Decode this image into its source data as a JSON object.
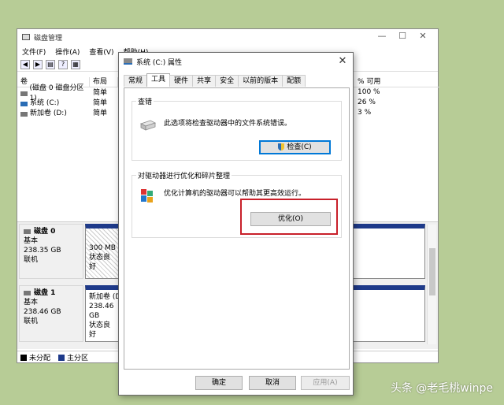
{
  "disk_manager": {
    "title": "磁盘管理",
    "menu": [
      "文件(F)",
      "操作(A)",
      "查看(V)",
      "帮助(H)"
    ],
    "columns": [
      "卷",
      "布局"
    ],
    "pct_header": "% 可用",
    "volumes": [
      {
        "name": "(磁盘 0 磁盘分区 1)",
        "layout": "简单",
        "pct": "100 %"
      },
      {
        "name": "系统 (C:)",
        "layout": "简单",
        "pct": "26 %"
      },
      {
        "name": "新加卷 (D:)",
        "layout": "简单",
        "pct": "3 %"
      }
    ],
    "disk0": {
      "name": "磁盘 0",
      "type": "基本",
      "size": "238.35 GB",
      "status": "联机",
      "part": {
        "size": "300 MB",
        "status": "状态良好"
      }
    },
    "disk1": {
      "name": "磁盘 1",
      "type": "基本",
      "size": "238.46 GB",
      "status": "联机",
      "part": {
        "name": "新加卷 (D",
        "size": "238.46 GB",
        "status": "状态良好"
      }
    },
    "legend": [
      "未分配",
      "主分区"
    ]
  },
  "dialog": {
    "title": "系统 (C:) 属性",
    "tabs": [
      "常规",
      "工具",
      "硬件",
      "共享",
      "安全",
      "以前的版本",
      "配额"
    ],
    "active_tab": "工具",
    "error_check": {
      "group": "查错",
      "text": "此选项将检查驱动器中的文件系统错误。",
      "button": "检查(C)"
    },
    "optimize": {
      "group": "对驱动器进行优化和碎片整理",
      "text": "优化计算机的驱动器可以帮助其更高效运行。",
      "button": "优化(O)"
    },
    "ok": "确定",
    "cancel": "取消",
    "apply": "应用(A)"
  },
  "watermark": "头条 @老毛桃winpe"
}
